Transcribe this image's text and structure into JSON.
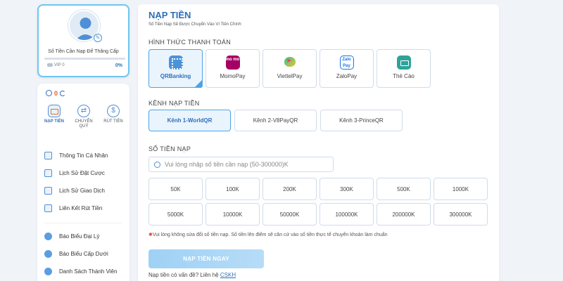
{
  "profile": {
    "upgrade_label": "Số Tiền Cần Nạp Để Thăng Cấp",
    "vip_label": "VIP 0",
    "progress_percent_label": "0%",
    "progress_fraction": 0
  },
  "wallet": {
    "balance": "0"
  },
  "quick_actions": [
    {
      "label": "NẠP TIỀN",
      "icon": "wallet-icon",
      "active": true
    },
    {
      "label": "CHUYỂN QUỸ",
      "icon": "transfer-icon",
      "active": false
    },
    {
      "label": "RÚT TIỀN",
      "icon": "withdraw-icon",
      "active": false
    }
  ],
  "menu": {
    "items": [
      {
        "label": "Thông Tin Cá Nhân",
        "icon": "profile-card-icon"
      },
      {
        "label": "Lịch Sử Đặt Cược",
        "icon": "bet-history-icon"
      },
      {
        "label": "Lịch Sử Giao Dịch",
        "icon": "transaction-history-icon"
      },
      {
        "label": "Liên Kết Rút Tiền",
        "icon": "bank-link-icon"
      }
    ],
    "agent_items": [
      {
        "label": "Báo Biểu Đại Lý",
        "icon": "report-icon"
      },
      {
        "label": "Báo Biểu Cấp Dưới",
        "icon": "subordinate-report-icon"
      },
      {
        "label": "Danh Sách Thành Viên",
        "icon": "members-icon"
      }
    ]
  },
  "main": {
    "title": "NẠP TIỀN",
    "subtitle": "Số Tiền Nạp Sẽ Được Chuyển Vào Ví Tiền Chính",
    "method_section_label": "HÌNH THỨC THANH TOÁN",
    "methods": [
      {
        "label": "QRBanking",
        "logo_text": "",
        "icon": "qr-banking-icon",
        "selected": true
      },
      {
        "label": "MomoPay",
        "logo_text": "mo mo",
        "icon": "momo-icon",
        "selected": false
      },
      {
        "label": "ViettelPay",
        "logo_text": "",
        "icon": "viettelpay-icon",
        "selected": false
      },
      {
        "label": "ZaloPay",
        "logo_text": "Zalo Pay",
        "icon": "zalopay-icon",
        "selected": false
      },
      {
        "label": "Thẻ Cào",
        "logo_text": "",
        "icon": "scratch-card-icon",
        "selected": false
      }
    ],
    "channel_section_label": "KÊNH NẠP TIỀN",
    "channels": [
      {
        "label": "Kênh 1-WorldQR",
        "selected": true
      },
      {
        "label": "Kênh 2-V8PayQR",
        "selected": false
      },
      {
        "label": "Kênh 3-PrinceQR",
        "selected": false
      }
    ],
    "amount_section_label": "SỐ TIỀN NẠP",
    "amount_placeholder": "Vui lòng nhập số tiền cần nạp (50-300000)K",
    "amounts": [
      "50K",
      "100K",
      "200K",
      "300K",
      "500K",
      "1000K",
      "5000K",
      "10000K",
      "50000K",
      "100000K",
      "200000K",
      "300000K"
    ],
    "note": "Vui lòng không sửa đổi số tiền nạp. Số tiền lên điểm sẽ căn cứ vào số tiền thực tế chuyển khoản làm chuẩn",
    "submit_label": "NẠP TIỀN NGAY",
    "help_text": "Nạp tiền có vấn đề? Liên hệ",
    "help_link": "CSKH"
  },
  "colors": {
    "accent": "#2d6fb8",
    "selected_border": "#4da3e8",
    "selected_bg": "#eaf4fd",
    "submit_bg": "#a9d6f6"
  }
}
